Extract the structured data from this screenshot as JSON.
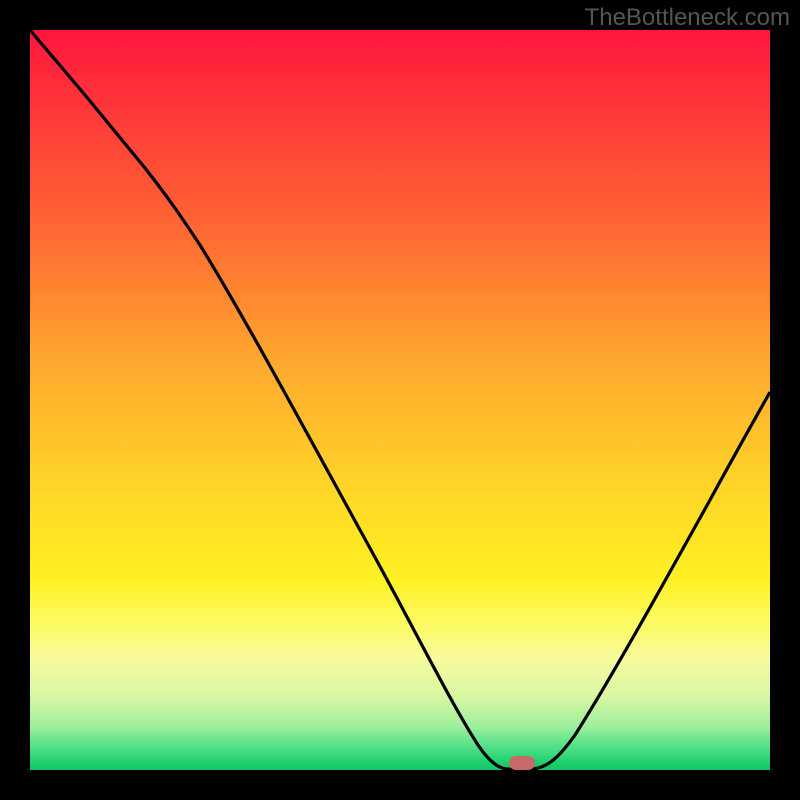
{
  "watermark": "TheBottleneck.com",
  "colors": {
    "background": "#000000",
    "curve": "#000000",
    "marker": "#c96a6a"
  },
  "chart_data": {
    "type": "line",
    "title": "",
    "xlabel": "",
    "ylabel": "",
    "xlim": [
      0,
      1
    ],
    "ylim": [
      0,
      1
    ],
    "x": [
      0.0,
      0.05,
      0.1,
      0.15,
      0.2,
      0.25,
      0.3,
      0.35,
      0.4,
      0.45,
      0.5,
      0.55,
      0.6,
      0.63,
      0.67,
      0.7,
      0.75,
      0.8,
      0.85,
      0.9,
      0.95,
      1.0
    ],
    "values": [
      1.0,
      0.93,
      0.86,
      0.79,
      0.71,
      0.62,
      0.52,
      0.42,
      0.32,
      0.22,
      0.13,
      0.06,
      0.01,
      0.0,
      0.0,
      0.02,
      0.07,
      0.14,
      0.21,
      0.29,
      0.37,
      0.45
    ],
    "marker_point": {
      "x": 0.665,
      "y": 0.0
    },
    "gradient_stops": [
      {
        "pos": 0.0,
        "color": "#ff153c"
      },
      {
        "pos": 0.25,
        "color": "#ff6134"
      },
      {
        "pos": 0.5,
        "color": "#ffc02b"
      },
      {
        "pos": 0.75,
        "color": "#fff023"
      },
      {
        "pos": 0.92,
        "color": "#c6f3a0"
      },
      {
        "pos": 1.0,
        "color": "#12c663"
      }
    ]
  }
}
